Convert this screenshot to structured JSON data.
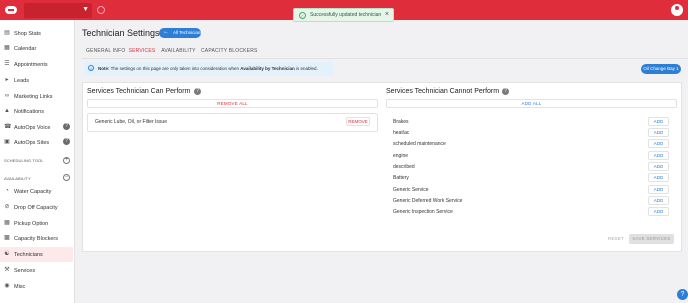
{
  "toast": {
    "message": "Successfully updated technician"
  },
  "sidebar": {
    "items": [
      {
        "label": "Shop Stats",
        "icon": "chart-icon"
      },
      {
        "label": "Calendar",
        "icon": "calendar-icon"
      },
      {
        "label": "Appointments",
        "icon": "list-icon"
      },
      {
        "label": "Leads",
        "icon": "megaphone-icon"
      },
      {
        "label": "Marketing Links",
        "icon": "link-icon"
      },
      {
        "label": "Notifications",
        "icon": "bell-icon"
      },
      {
        "label": "AutoOps Voice",
        "icon": "phone-icon"
      },
      {
        "label": "AutoOps Sites",
        "icon": "browser-icon"
      },
      {
        "label": "Water Capacity",
        "icon": "gauge-icon"
      },
      {
        "label": "Drop Off Capacity",
        "icon": "block-icon"
      },
      {
        "label": "Pickup Option",
        "icon": "grid-icon"
      },
      {
        "label": "Capacity Blockers",
        "icon": "card-icon"
      },
      {
        "label": "Technicians",
        "icon": "technicians-icon"
      },
      {
        "label": "Services",
        "icon": "wrench-icon"
      },
      {
        "label": "Misc",
        "icon": "toggle-icon"
      }
    ],
    "sections": {
      "scheduling": "SCHEDULING TOOL",
      "availability": "AVAILABILITY"
    }
  },
  "page": {
    "title": "Technician Settings",
    "all_technicians": "All Technicians"
  },
  "tabs": [
    {
      "label": "GENERAL INFO"
    },
    {
      "label": "SERVICES",
      "active": true
    },
    {
      "label": "AVAILABILITY"
    },
    {
      "label": "CAPACITY BLOCKERS"
    }
  ],
  "note": {
    "prefix": "Note:",
    "text": " The settings on this page are only taken into consideration when ",
    "emphasis": "Availability by Technician",
    "suffix": " is enabled."
  },
  "oil_bay_button": "Oil Change Bay 1",
  "can_perform": {
    "title": "Services Technician Can Perform",
    "remove_all": "REMOVE ALL",
    "services": [
      {
        "name": "Generic Lube, Oil, or Filter Issue",
        "action": "REMOVE"
      }
    ]
  },
  "cannot_perform": {
    "title": "Services Technician Cannot Perform",
    "add_all": "ADD ALL",
    "action": "ADD",
    "services": [
      {
        "name": "Brakes"
      },
      {
        "name": "heat/ac"
      },
      {
        "name": "scheduled maintenance"
      },
      {
        "name": "engine"
      },
      {
        "name": "described"
      },
      {
        "name": "Battery"
      },
      {
        "name": "Generic Service"
      },
      {
        "name": "Generic Deferred Work Service"
      },
      {
        "name": "Generic Inspection Service"
      }
    ]
  },
  "footer": {
    "reset": "RESET",
    "save": "SAVE SERVICES"
  },
  "colors": {
    "brand": "#e02d3c",
    "accent": "#2d7fd6"
  }
}
